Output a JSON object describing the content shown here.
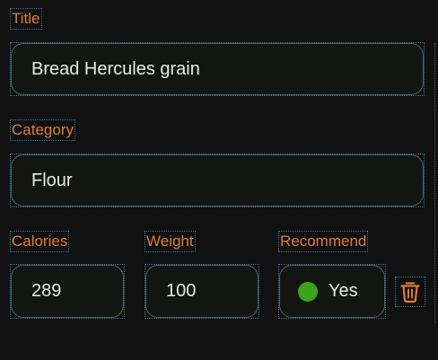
{
  "form": {
    "title_label": "Title",
    "title_value": "Bread Hercules grain",
    "category_label": "Category",
    "category_value": "Flour",
    "calories_label": "Calories",
    "calories_value": "289",
    "weight_label": "Weight",
    "weight_value": "100",
    "recommend_label": "Recommend",
    "recommend_value": "Yes"
  },
  "colors": {
    "label_orange": "#e07b3d",
    "dot_green": "#3aa319",
    "trash_orange": "#e07b3d"
  },
  "icons": {
    "recommend_indicator": "green-dot-icon",
    "delete": "trash-icon"
  }
}
